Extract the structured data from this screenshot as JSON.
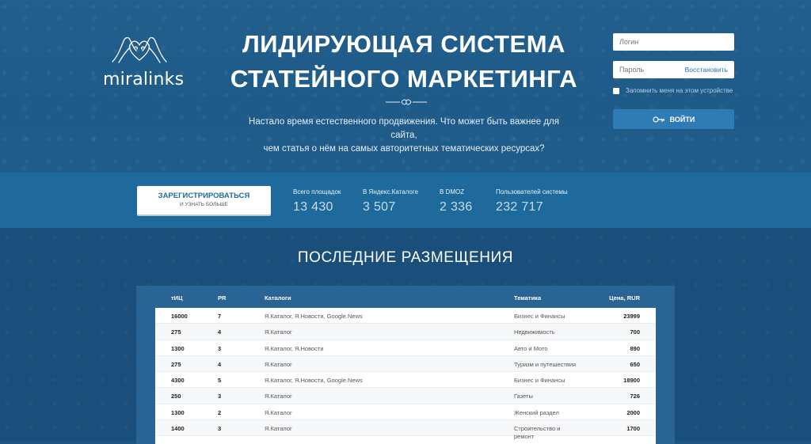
{
  "brand": {
    "name": "miralinks"
  },
  "hero": {
    "headline_line1": "ЛИДИРУЮЩАЯ СИСТЕМА",
    "headline_line2": "СТАТЕЙНОГО МАРКЕТИНГА",
    "subtext_line1": "Настало время естественного продвижения. Что может быть важнее для сайта,",
    "subtext_line2": "чем статья о нём на самых авторитетных тематических ресурсах?"
  },
  "login": {
    "login_placeholder": "Логин",
    "password_placeholder": "Пароль",
    "restore_label": "Восстановить",
    "remember_label": "Запомнить меня на этом устройстве",
    "submit_label": "ВОЙТИ"
  },
  "register": {
    "title": "ЗАРЕГИСТРИРОВАТЬСЯ",
    "subtitle": "И УЗНАТЬ БОЛЬШЕ"
  },
  "stats": [
    {
      "label": "Всего площадок",
      "value": "13 430"
    },
    {
      "label": "В Яндекс.Каталоге",
      "value": "3 507"
    },
    {
      "label": "В DMOZ",
      "value": "2 336"
    },
    {
      "label": "Пользователей системы",
      "value": "232 717"
    }
  ],
  "placements": {
    "title": "ПОСЛЕДНИЕ РАЗМЕЩЕНИЯ",
    "columns": {
      "tic": "тИЦ",
      "pr": "PR",
      "catalogs": "Каталоги",
      "topic": "Тематика",
      "price": "Цена, RUR"
    },
    "rows": [
      {
        "tic": "16000",
        "pr": "7",
        "catalogs": "Я.Каталог, Я.Новости, Google.News",
        "topic": "Бизнес и Финансы",
        "price": "23999"
      },
      {
        "tic": "275",
        "pr": "4",
        "catalogs": "Я.Каталог",
        "topic": "Недвижимость",
        "price": "700"
      },
      {
        "tic": "1300",
        "pr": "3",
        "catalogs": "Я.Каталог, Я.Новости",
        "topic": "Авто и Мото",
        "price": "890"
      },
      {
        "tic": "275",
        "pr": "4",
        "catalogs": "Я.Каталог",
        "topic": "Туризм и путешествия",
        "price": "650"
      },
      {
        "tic": "4300",
        "pr": "5",
        "catalogs": "Я.Каталог, Я.Новости, Google.News",
        "topic": "Бизнес и Финансы",
        "price": "18900"
      },
      {
        "tic": "250",
        "pr": "3",
        "catalogs": "Я.Каталог",
        "topic": "Газеты",
        "price": "726"
      },
      {
        "tic": "1300",
        "pr": "2",
        "catalogs": "Я.Каталог",
        "topic": "Женский раздел",
        "price": "2000"
      },
      {
        "tic": "1400",
        "pr": "3",
        "catalogs": "Я.Каталог",
        "topic": "Строительство и ремонт",
        "price": "1700"
      }
    ]
  }
}
